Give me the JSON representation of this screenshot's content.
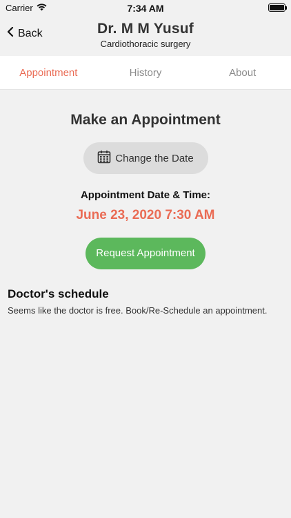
{
  "status_bar": {
    "carrier": "Carrier",
    "time": "7:34 AM",
    "wifi_icon": "wifi-icon",
    "battery_icon": "battery-icon"
  },
  "header": {
    "back_label": "Back",
    "title": "Dr. M M Yusuf",
    "subtitle": "Cardiothoracic surgery"
  },
  "tabs": [
    {
      "label": "Appointment",
      "active": true
    },
    {
      "label": "History",
      "active": false
    },
    {
      "label": "About",
      "active": false
    }
  ],
  "appointment": {
    "heading": "Make an Appointment",
    "change_date_label": "Change the Date",
    "date_label": "Appointment Date & Time:",
    "date_value": "June 23, 2020 7:30 AM",
    "request_label": "Request Appointment"
  },
  "schedule": {
    "title": "Doctor's schedule",
    "text": "Seems like the doctor is free. Book/Re-Schedule an appointment."
  },
  "colors": {
    "accent": "#ea6c55",
    "success": "#5cb85c",
    "background": "#f1f1f1"
  }
}
